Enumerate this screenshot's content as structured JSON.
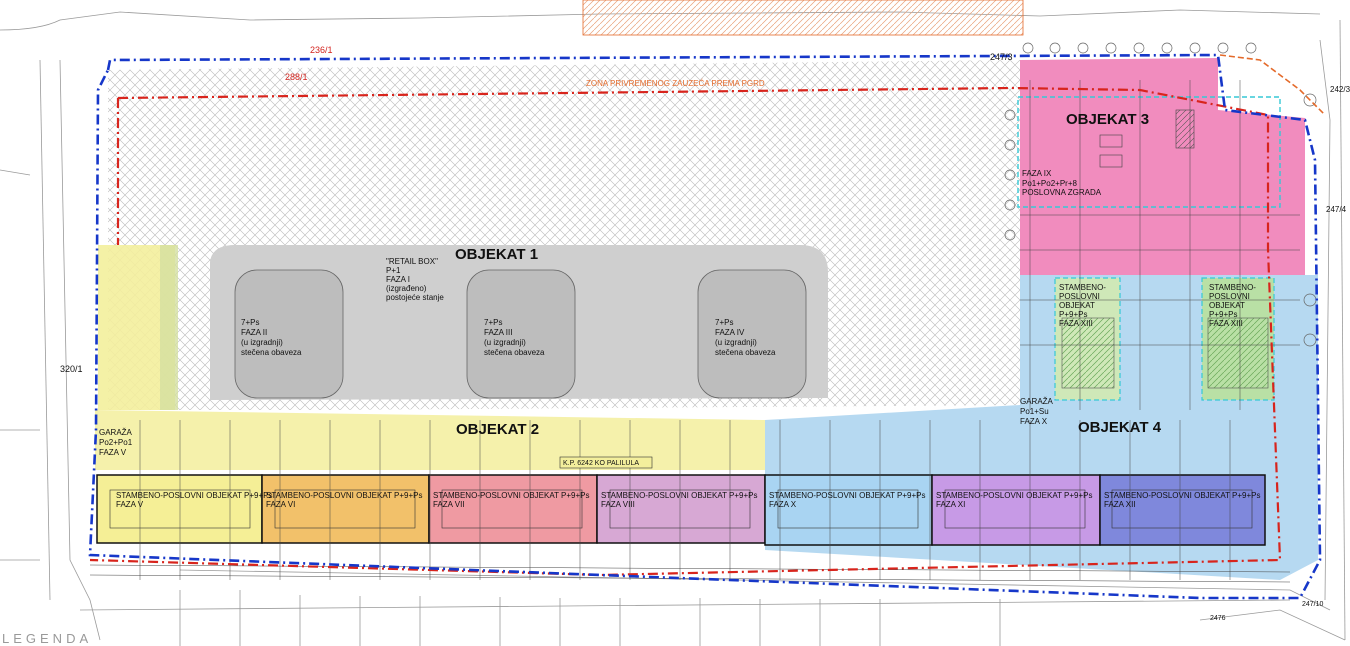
{
  "colors": {
    "objekat3": "#ef7fb7",
    "objekat4": "#a9d2ef",
    "objekat2": "#f3ef9c",
    "faza_v": "#f5ef96",
    "faza_vi": "#f2c16a",
    "faza_vii": "#ef9aa2",
    "faza_viii": "#d7a8d4",
    "faza_x": "#a9d4f2",
    "faza_xi": "#c79ae6",
    "faza_xii": "#7f88dc",
    "retail": "#cfcfcf",
    "boundary_blue": "#1637c9",
    "boundary_red": "#d8241c",
    "accent_cyan": "#36c9d6",
    "green_box": "#cfe8b8"
  },
  "labels": {
    "objekat1": "OBJEKAT 1",
    "objekat2": "OBJEKAT 2",
    "objekat3": "OBJEKAT 3",
    "objekat4": "OBJEKAT 4",
    "zona": "ZONA PRIVREMENOG ZAUZEĆA PREMA PGRD",
    "retail_1": "\"RETAIL BOX\"",
    "retail_2": "P+1",
    "retail_3": "FAZA I",
    "retail_4": "(izgrađeno)",
    "retail_5": "postojeće stanje",
    "kp": "K.P. 6242 KO PALILULA",
    "legend": "LEGENDA"
  },
  "phase_boxes": [
    {
      "line1": "7+Ps",
      "line2": "FAZA II",
      "line3": "(u izgradnji)",
      "line4": "stečena obaveza"
    },
    {
      "line1": "7+Ps",
      "line2": "FAZA III",
      "line3": "(u izgradnji)",
      "line4": "stečena obaveza"
    },
    {
      "line1": "7+Ps",
      "line2": "FAZA IV",
      "line3": "(u izgradnji)",
      "line4": "stečena obaveza"
    }
  ],
  "faza_ix": {
    "line1": "FAZA IX",
    "line2": "Po1+Po2+Pr+8",
    "line3": "POSLOVNA ZGRADA"
  },
  "garaza_left": {
    "line1": "GARAŽA",
    "line2": "Po2+Po1",
    "line3": "FAZA V"
  },
  "garaza_right": {
    "line1": "GARAŽA",
    "line2": "Po1+Su",
    "line3": "FAZA X"
  },
  "green_buildings": [
    {
      "l1": "STAMBENO-",
      "l2": "POSLOVNI",
      "l3": "OBJEKAT",
      "l4": "P+9+Ps",
      "l5": "FAZA XIII"
    },
    {
      "l1": "STAMBENO-",
      "l2": "POSLOVNI",
      "l3": "OBJEKAT",
      "l4": "P+9+Ps",
      "l5": "FAZA XIII"
    }
  ],
  "strip": [
    {
      "title": "STAMBENO-POSLOVNI OBJEKAT P+9+Ps",
      "faza": "FAZA V"
    },
    {
      "title": "STAMBENO-POSLOVNI OBJEKAT P+9+Ps",
      "faza": "FAZA VI"
    },
    {
      "title": "STAMBENO-POSLOVNI OBJEKAT P+9+Ps",
      "faza": "FAZA VII"
    },
    {
      "title": "STAMBENO-POSLOVNI OBJEKAT P+9+Ps",
      "faza": "FAZA VIII"
    },
    {
      "title": "STAMBENO-POSLOVNI OBJEKAT P+9+Ps",
      "faza": "FAZA X"
    },
    {
      "title": "STAMBENO-POSLOVNI OBJEKAT P+9+Ps",
      "faza": "FAZA XI"
    },
    {
      "title": "STAMBENO-POSLOVNI OBJEKAT P+9+Ps",
      "faza": "FAZA XII"
    }
  ],
  "parcels": {
    "p1": "236/1",
    "p2": "247/3",
    "p3": "320/1",
    "p4": "242/3",
    "p5": "247/4",
    "p6": "247/10",
    "p7": "2476",
    "p8": "288/1"
  }
}
